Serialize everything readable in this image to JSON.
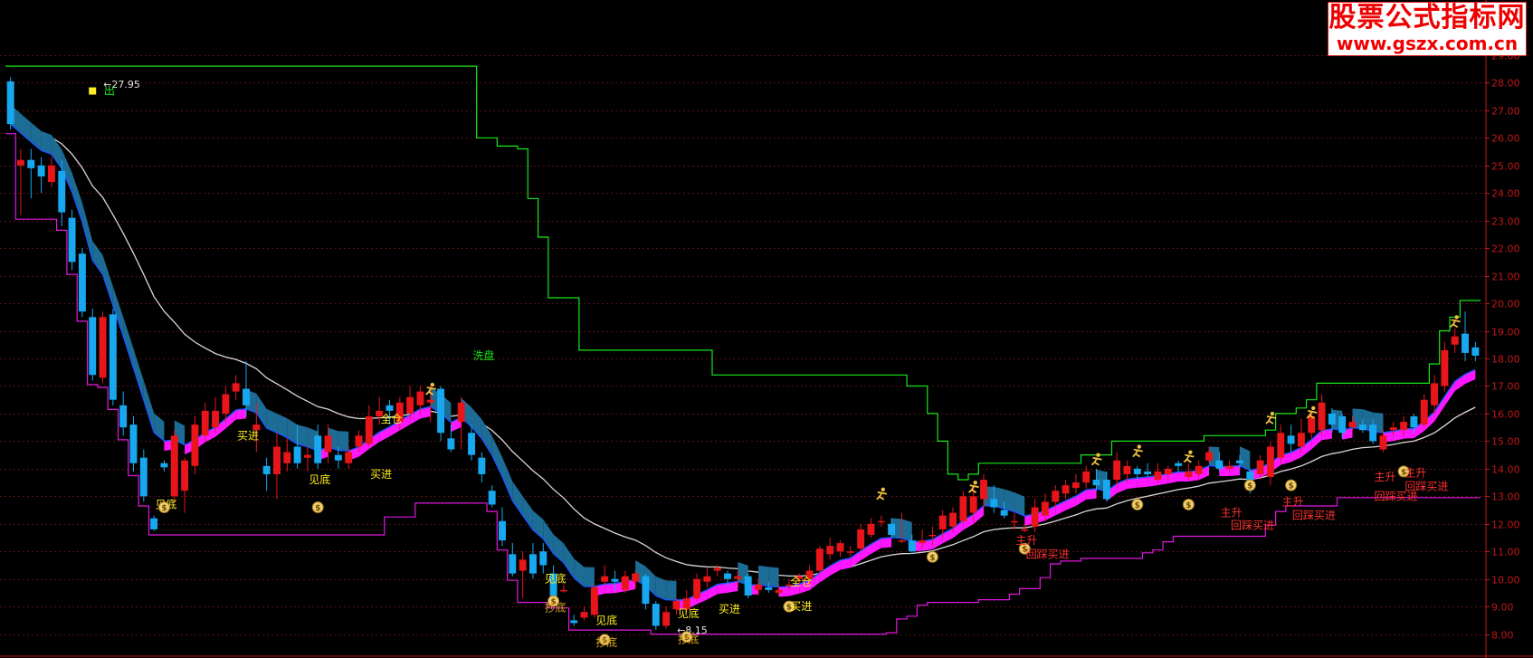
{
  "watermark": {
    "title": "股票公式指标网",
    "url": "www.gszx.com.cn"
  },
  "chart_data": {
    "type": "candlestick",
    "ylim": [
      7.2,
      31.0
    ],
    "y_ticks": [
      "8.00",
      "9.00",
      "10.00",
      "11.00",
      "12.00",
      "13.00",
      "14.00",
      "15.00",
      "16.00",
      "17.00",
      "18.00",
      "19.00",
      "20.00",
      "21.00",
      "22.00",
      "23.00",
      "24.00",
      "25.00",
      "26.00",
      "27.00",
      "28.00",
      "29.00"
    ],
    "colors": {
      "up": "#e8151b",
      "down": "#18a8f0",
      "ribbon_down": "#1c6c96",
      "ribbon_up": "#ff18ff",
      "mid_line": "#1c54ff",
      "slow_line": "#d8d8d8",
      "upper_step": "#18e818",
      "lower_step": "#e018e0",
      "axis": "#c01818",
      "label_yellow": "#ffee22",
      "label_green": "#18e818",
      "label_red": "#ff3030"
    },
    "candles": [
      [
        28.05,
        26.5,
        28.2,
        26.3
      ],
      [
        25.0,
        25.2,
        25.6,
        23.2
      ],
      [
        25.2,
        24.9,
        25.6,
        23.8
      ],
      [
        25.0,
        24.6,
        25.3,
        24.0
      ],
      [
        24.4,
        25.0,
        25.3,
        24.2
      ],
      [
        24.8,
        23.3,
        25.2,
        22.8
      ],
      [
        23.1,
        21.5,
        23.4,
        21.2
      ],
      [
        21.8,
        19.7,
        22.0,
        19.5
      ],
      [
        19.5,
        17.4,
        19.8,
        17.2
      ],
      [
        17.3,
        19.5,
        19.7,
        17.1
      ],
      [
        19.6,
        16.5,
        19.8,
        16.3
      ],
      [
        16.3,
        15.5,
        16.8,
        15.2
      ],
      [
        15.6,
        14.2,
        15.9,
        13.9
      ],
      [
        14.4,
        13.0,
        14.7,
        12.8
      ],
      [
        12.2,
        11.8,
        12.3,
        11.75
      ],
      [
        14.2,
        14.05,
        14.3,
        13.9
      ],
      [
        13.0,
        15.2,
        15.4,
        12.8
      ],
      [
        13.2,
        14.3,
        14.4,
        12.4
      ],
      [
        14.1,
        15.6,
        15.9,
        13.8
      ],
      [
        15.2,
        16.1,
        16.4,
        15.0
      ],
      [
        15.5,
        16.1,
        16.6,
        15.3
      ],
      [
        16.0,
        16.7,
        17.0,
        15.7
      ],
      [
        16.8,
        17.1,
        17.4,
        16.5
      ],
      [
        16.9,
        16.3,
        17.9,
        15.9
      ],
      [
        15.4,
        15.6,
        16.4,
        14.6
      ],
      [
        14.1,
        13.8,
        14.4,
        13.2
      ],
      [
        13.8,
        14.8,
        15.3,
        12.9
      ],
      [
        14.2,
        14.6,
        15.1,
        13.9
      ],
      [
        14.8,
        14.2,
        15.6,
        14.0
      ],
      [
        14.4,
        14.5,
        14.8,
        13.9
      ],
      [
        15.2,
        14.2,
        15.6,
        14.0
      ],
      [
        14.6,
        15.2,
        15.6,
        14.2
      ],
      [
        14.5,
        14.3,
        14.8,
        14.0
      ],
      [
        14.2,
        14.6,
        14.8,
        14.0
      ],
      [
        14.8,
        15.2,
        15.4,
        14.6
      ],
      [
        14.9,
        15.9,
        16.3,
        14.8
      ],
      [
        15.9,
        16.1,
        16.6,
        15.6
      ],
      [
        16.3,
        16.1,
        16.5,
        15.6
      ],
      [
        15.7,
        16.4,
        16.6,
        15.4
      ],
      [
        16.0,
        16.6,
        17.0,
        15.8
      ],
      [
        16.3,
        16.8,
        17.0,
        16.0
      ],
      [
        16.4,
        16.5,
        17.0,
        15.7
      ],
      [
        16.9,
        15.3,
        17.0,
        15.0
      ],
      [
        15.1,
        14.7,
        15.6,
        14.6
      ],
      [
        15.7,
        16.4,
        16.6,
        14.7
      ],
      [
        15.3,
        14.5,
        15.6,
        14.3
      ],
      [
        14.4,
        13.8,
        14.6,
        13.5
      ],
      [
        13.2,
        12.7,
        13.4,
        12.6
      ],
      [
        12.1,
        11.4,
        12.6,
        11.2
      ],
      [
        10.9,
        10.2,
        11.3,
        10.1
      ],
      [
        10.3,
        10.7,
        11.0,
        9.3
      ],
      [
        10.9,
        10.2,
        11.3,
        10.0
      ],
      [
        11.0,
        10.5,
        11.3,
        10.2
      ],
      [
        10.2,
        9.3,
        10.5,
        9.1
      ],
      [
        9.6,
        9.6,
        9.8,
        9.5
      ],
      [
        8.5,
        8.4,
        8.7,
        8.3
      ],
      [
        8.6,
        8.8,
        9.0,
        8.5
      ],
      [
        8.7,
        9.7,
        9.8,
        8.6
      ],
      [
        9.9,
        10.1,
        10.5,
        9.8
      ],
      [
        10.0,
        9.9,
        10.3,
        9.6
      ],
      [
        9.6,
        10.1,
        10.3,
        9.5
      ],
      [
        9.9,
        10.2,
        10.3,
        9.7
      ],
      [
        10.1,
        9.1,
        10.2,
        8.9
      ],
      [
        9.1,
        8.3,
        9.2,
        8.15
      ],
      [
        8.3,
        8.8,
        9.0,
        8.2
      ],
      [
        8.9,
        9.2,
        9.3,
        8.7
      ],
      [
        8.9,
        9.3,
        9.6,
        8.8
      ],
      [
        9.3,
        10.0,
        10.2,
        9.2
      ],
      [
        9.9,
        10.1,
        10.4,
        9.7
      ],
      [
        10.3,
        10.4,
        10.5,
        10.1
      ],
      [
        10.2,
        10.0,
        10.3,
        9.7
      ],
      [
        10.0,
        10.1,
        10.3,
        9.7
      ],
      [
        10.1,
        9.4,
        10.2,
        9.3
      ],
      [
        9.6,
        9.8,
        10.0,
        9.4
      ],
      [
        9.7,
        9.6,
        9.9,
        9.5
      ],
      [
        9.5,
        9.6,
        9.8,
        9.4
      ],
      [
        9.8,
        9.8,
        10.0,
        9.6
      ],
      [
        10.0,
        10.1,
        10.2,
        9.8
      ],
      [
        10.0,
        10.3,
        10.5,
        9.8
      ],
      [
        10.3,
        11.1,
        11.2,
        10.2
      ],
      [
        10.9,
        11.2,
        11.5,
        10.7
      ],
      [
        11.0,
        11.3,
        11.4,
        10.8
      ],
      [
        11.0,
        11.0,
        11.2,
        10.8
      ],
      [
        11.1,
        11.8,
        12.0,
        11.0
      ],
      [
        11.6,
        12.0,
        12.2,
        11.5
      ],
      [
        12.1,
        12.1,
        12.3,
        11.9
      ],
      [
        12.0,
        11.6,
        12.2,
        11.5
      ],
      [
        11.4,
        11.4,
        12.4,
        11.3
      ],
      [
        11.4,
        11.0,
        11.6,
        10.9
      ],
      [
        11.3,
        11.4,
        11.8,
        11.1
      ],
      [
        11.6,
        11.6,
        11.9,
        11.2
      ],
      [
        11.8,
        12.3,
        12.5,
        11.5
      ],
      [
        11.9,
        12.4,
        12.6,
        11.7
      ],
      [
        12.1,
        13.0,
        13.2,
        12.0
      ],
      [
        12.4,
        13.0,
        13.4,
        12.1
      ],
      [
        12.9,
        13.6,
        13.8,
        12.6
      ],
      [
        12.9,
        12.6,
        13.4,
        12.4
      ],
      [
        12.5,
        12.3,
        12.8,
        12.2
      ],
      [
        12.1,
        12.1,
        12.4,
        11.8
      ],
      [
        11.8,
        11.8,
        12.0,
        11.7
      ],
      [
        11.9,
        12.6,
        12.9,
        11.7
      ],
      [
        12.3,
        12.8,
        13.1,
        12.1
      ],
      [
        12.8,
        13.2,
        13.4,
        12.6
      ],
      [
        13.1,
        13.4,
        13.6,
        12.9
      ],
      [
        13.3,
        13.5,
        13.8,
        13.1
      ],
      [
        13.5,
        13.9,
        14.1,
        13.3
      ],
      [
        13.6,
        13.4,
        14.0,
        13.2
      ],
      [
        13.6,
        12.9,
        13.9,
        12.8
      ],
      [
        13.6,
        14.3,
        14.6,
        13.4
      ],
      [
        13.8,
        14.1,
        14.3,
        13.5
      ],
      [
        14.0,
        13.8,
        14.1,
        13.6
      ],
      [
        13.9,
        13.8,
        14.2,
        13.7
      ],
      [
        13.6,
        13.9,
        14.2,
        13.5
      ],
      [
        13.8,
        14.0,
        14.1,
        13.6
      ],
      [
        14.2,
        14.1,
        14.3,
        13.9
      ],
      [
        13.7,
        13.9,
        14.2,
        13.6
      ],
      [
        13.8,
        14.1,
        14.3,
        13.7
      ],
      [
        14.3,
        14.6,
        14.8,
        14.2
      ],
      [
        14.3,
        14.0,
        14.6,
        13.9
      ],
      [
        14.0,
        14.1,
        14.3,
        13.9
      ],
      [
        14.3,
        14.2,
        14.5,
        14.0
      ],
      [
        13.9,
        13.4,
        14.0,
        13.1
      ],
      [
        13.8,
        14.3,
        14.5,
        13.6
      ],
      [
        13.7,
        14.8,
        15.0,
        13.4
      ],
      [
        14.4,
        15.3,
        15.6,
        14.2
      ],
      [
        15.2,
        14.9,
        15.6,
        14.6
      ],
      [
        14.8,
        15.3,
        15.8,
        14.6
      ],
      [
        15.3,
        15.9,
        16.1,
        15.1
      ],
      [
        15.4,
        16.4,
        16.7,
        15.2
      ],
      [
        16.0,
        15.6,
        16.2,
        15.3
      ],
      [
        15.9,
        15.3,
        16.0,
        15.1
      ],
      [
        15.5,
        15.7,
        15.9,
        15.4
      ],
      [
        15.6,
        15.4,
        15.8,
        15.3
      ],
      [
        15.6,
        15.0,
        15.8,
        14.9
      ],
      [
        14.7,
        15.2,
        15.4,
        14.6
      ],
      [
        15.4,
        15.5,
        15.7,
        15.2
      ],
      [
        15.4,
        15.7,
        15.9,
        15.2
      ],
      [
        15.9,
        15.5,
        16.0,
        15.3
      ],
      [
        15.6,
        16.5,
        16.7,
        15.5
      ],
      [
        16.3,
        17.1,
        17.4,
        16.0
      ],
      [
        17.0,
        18.3,
        18.6,
        16.8
      ],
      [
        18.5,
        18.8,
        19.1,
        18.2
      ],
      [
        18.9,
        18.2,
        19.7,
        17.9
      ],
      [
        18.4,
        18.1,
        18.6,
        17.9
      ]
    ],
    "annotations": [
      {
        "i": 8,
        "price": 27.95,
        "text": "27.95",
        "kind": "price",
        "color": "#e0e0e0"
      },
      {
        "i": 8,
        "price": 27.7,
        "text": "",
        "kind": "icon"
      },
      {
        "i": 10,
        "price": 27.7,
        "text": "出",
        "color": "#18e818"
      },
      {
        "i": 15,
        "price": 12.7,
        "text": "见底",
        "color": "#ffee22"
      },
      {
        "i": 15,
        "price": 12.6,
        "kind": "bag"
      },
      {
        "i": 23,
        "price": 15.2,
        "text": "买进",
        "color": "#ffee22"
      },
      {
        "i": 30,
        "price": 13.6,
        "text": "见底",
        "color": "#ffee22"
      },
      {
        "i": 30,
        "price": 12.6,
        "kind": "bag"
      },
      {
        "i": 36,
        "price": 13.8,
        "text": "买进",
        "color": "#ffee22"
      },
      {
        "i": 37,
        "price": 15.8,
        "text": "全仓",
        "color": "#ffee22"
      },
      {
        "i": 41,
        "price": 16.85,
        "kind": "runner"
      },
      {
        "i": 46,
        "price": 18.1,
        "text": "洗盘",
        "color": "#18e818"
      },
      {
        "i": 53,
        "price": 10.0,
        "text": "见底",
        "color": "#ffee22"
      },
      {
        "i": 53,
        "price": 9.2,
        "kind": "bag"
      },
      {
        "i": 53,
        "price": 8.95,
        "text": "抄底",
        "color": "#d8a020"
      },
      {
        "i": 58,
        "price": 8.5,
        "text": "见底",
        "color": "#ffee22"
      },
      {
        "i": 58,
        "price": 7.8,
        "kind": "bag"
      },
      {
        "i": 58,
        "price": 7.7,
        "text": "抄底",
        "color": "#d8a020"
      },
      {
        "i": 64,
        "price": 8.15,
        "text": "8.15",
        "kind": "price",
        "color": "#e0e0e0"
      },
      {
        "i": 66,
        "price": 8.75,
        "text": "见底",
        "color": "#ffee22"
      },
      {
        "i": 66,
        "price": 7.9,
        "kind": "bag"
      },
      {
        "i": 66,
        "price": 7.8,
        "text": "抄底",
        "color": "#d8a020"
      },
      {
        "i": 70,
        "price": 8.9,
        "text": "买进",
        "color": "#ffee22"
      },
      {
        "i": 76,
        "price": 9.0,
        "kind": "bag"
      },
      {
        "i": 77,
        "price": 9.0,
        "text": "买进",
        "color": "#ffee22"
      },
      {
        "i": 77,
        "price": 9.9,
        "text": "全仓",
        "color": "#ffee22"
      },
      {
        "i": 85,
        "price": 13.05,
        "kind": "runner"
      },
      {
        "i": 90,
        "price": 10.8,
        "kind": "bag"
      },
      {
        "i": 94,
        "price": 13.3,
        "kind": "runner"
      },
      {
        "i": 99,
        "price": 11.1,
        "kind": "bag"
      },
      {
        "i": 99,
        "price": 11.4,
        "text": "主升",
        "color": "#ff3030"
      },
      {
        "i": 100,
        "price": 10.9,
        "text": "回踩买进",
        "color": "#ff3030"
      },
      {
        "i": 106,
        "price": 14.3,
        "kind": "runner"
      },
      {
        "i": 110,
        "price": 12.7,
        "kind": "bag"
      },
      {
        "i": 110,
        "price": 14.6,
        "kind": "runner"
      },
      {
        "i": 115,
        "price": 12.7,
        "kind": "bag"
      },
      {
        "i": 115,
        "price": 14.4,
        "kind": "runner"
      },
      {
        "i": 121,
        "price": 13.4,
        "kind": "bag"
      },
      {
        "i": 119,
        "price": 12.4,
        "text": "主升",
        "color": "#ff3030"
      },
      {
        "i": 120,
        "price": 11.95,
        "text": "回踩买进",
        "color": "#ff3030"
      },
      {
        "i": 123,
        "price": 15.8,
        "kind": "runner"
      },
      {
        "i": 125,
        "price": 13.4,
        "kind": "bag"
      },
      {
        "i": 125,
        "price": 12.8,
        "text": "主升",
        "color": "#ff3030"
      },
      {
        "i": 126,
        "price": 12.3,
        "text": "回踩买进",
        "color": "#ff3030"
      },
      {
        "i": 127,
        "price": 16.0,
        "kind": "runner"
      },
      {
        "i": 136,
        "price": 13.9,
        "kind": "bag"
      },
      {
        "i": 134,
        "price": 13.7,
        "text": "主升",
        "color": "#ff3030"
      },
      {
        "i": 134,
        "price": 13.0,
        "text": "回踩买进",
        "color": "#ff3030"
      },
      {
        "i": 137,
        "price": 13.85,
        "text": "主升",
        "color": "#ff3030"
      },
      {
        "i": 137,
        "price": 13.35,
        "text": "回踩买进",
        "color": "#ff3030"
      },
      {
        "i": 141,
        "price": 19.3,
        "kind": "runner"
      }
    ]
  }
}
